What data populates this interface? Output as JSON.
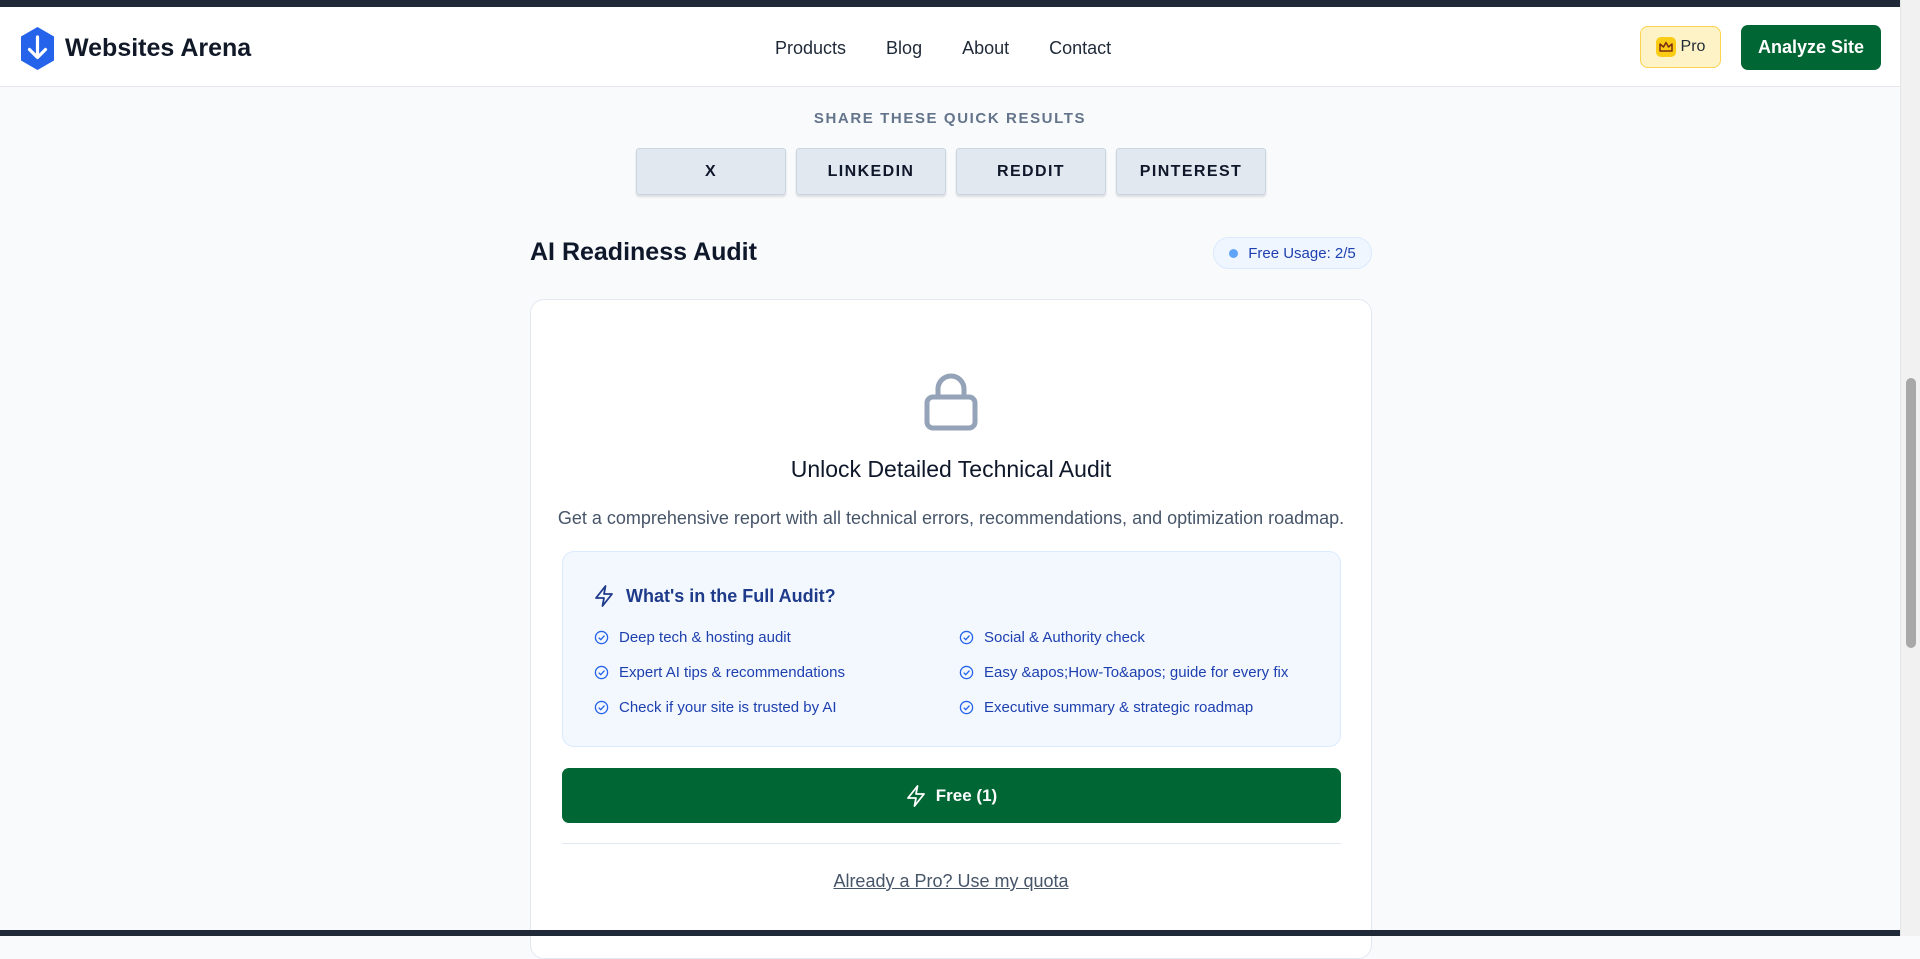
{
  "header": {
    "brand_name": "Websites Arena",
    "nav": [
      "Products",
      "Blog",
      "About",
      "Contact"
    ],
    "pro_label": "Pro",
    "analyze_label": "Analyze Site"
  },
  "share": {
    "title": "SHARE THESE QUICK RESULTS",
    "buttons": [
      "X",
      "LINKEDIN",
      "REDDIT",
      "PINTEREST"
    ]
  },
  "audit": {
    "title": "AI Readiness Audit",
    "usage": "Free Usage: 2/5",
    "card_title": "Unlock Detailed Technical Audit",
    "card_desc": "Get a comprehensive report with all technical errors, recommendations, and optimization roadmap.",
    "features_title": "What's in the Full Audit?",
    "features": [
      "Deep tech & hosting audit",
      "Social & Authority check",
      "Expert AI tips & recommendations",
      "Easy &apos;How-To&apos; guide for every fix",
      "Check if your site is trusted by AI",
      "Executive summary & strategic roadmap"
    ],
    "free_button": "Free (1)",
    "quota_link": "Already a Pro? Use my quota"
  },
  "colors": {
    "accent_green": "#006633",
    "brand_blue": "#2563eb",
    "feature_blue": "#1e40af"
  }
}
